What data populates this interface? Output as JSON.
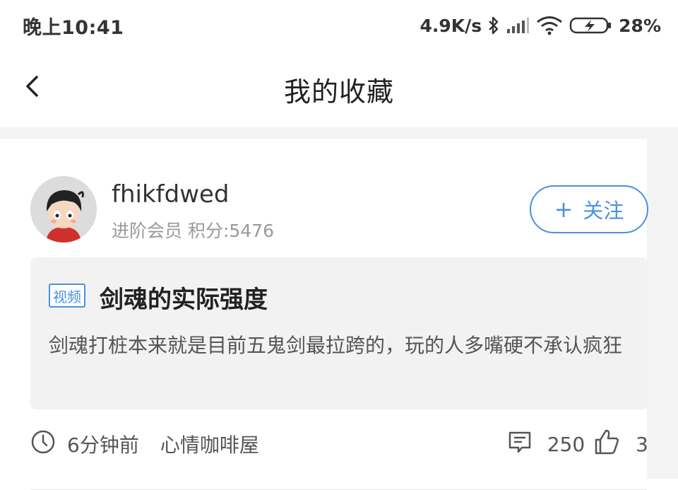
{
  "statusbar": {
    "time": "晚上10:41",
    "speed": "4.9K/s",
    "battery_percent": "28%",
    "icons": [
      "bluetooth-icon",
      "signal-icon",
      "wifi-icon",
      "battery-charging-icon"
    ]
  },
  "navbar": {
    "title": "我的收藏",
    "back_icon": "chevron-left-icon"
  },
  "post": {
    "user": {
      "name": "fhikfdwed",
      "meta": "进阶会员 积分:5476"
    },
    "follow_label": "关注",
    "follow_plus": "+",
    "badge": "视频",
    "title": "剑魂的实际强度",
    "body": " 剑魂打桩本来就是目前五鬼剑最拉跨的，玩的人多嘴硬不承认疯狂",
    "time_ago": "6分钟前",
    "category": "心情咖啡屋",
    "comment_count": "250",
    "like_count": "3"
  },
  "colors": {
    "accent": "#4a90e2",
    "background": "#f3f3f3",
    "card": "#ffffff",
    "post_box": "#f2f2f2"
  }
}
